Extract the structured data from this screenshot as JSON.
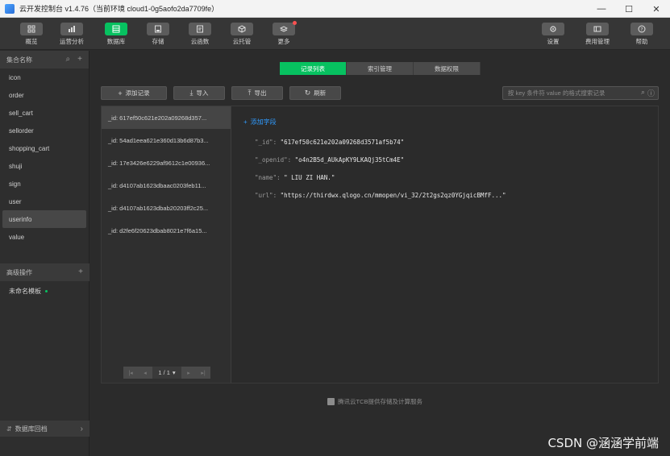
{
  "window": {
    "title": "云开发控制台 v1.4.76（当前环境 cloud1-0g5aofo2da7709fe）",
    "controls": [
      "—",
      "☐",
      "✕"
    ]
  },
  "toolbar": {
    "left": [
      {
        "label": "概览",
        "icon": "overview-icon"
      },
      {
        "label": "运营分析",
        "icon": "analytics-icon"
      },
      {
        "label": "数据库",
        "icon": "database-icon",
        "active": true
      },
      {
        "label": "存储",
        "icon": "storage-icon"
      },
      {
        "label": "云函数",
        "icon": "function-icon"
      },
      {
        "label": "云托管",
        "icon": "cloud-hosting-icon"
      },
      {
        "label": "更多",
        "icon": "more-icon",
        "badge": true
      }
    ],
    "right": [
      {
        "label": "设置",
        "icon": "gear-icon"
      },
      {
        "label": "费用管理",
        "icon": "billing-icon"
      },
      {
        "label": "帮助",
        "icon": "help-icon"
      }
    ]
  },
  "sidebar": {
    "header": "集合名称",
    "collections": [
      "icon",
      "order",
      "sell_cart",
      "sellorder",
      "shopping_cart",
      "shuji",
      "sign",
      "user",
      "userinfo",
      "value"
    ],
    "selected_collection": "userinfo",
    "advanced_header": "高级操作",
    "template_label": "未命名模板",
    "footer": "数据库回档"
  },
  "main": {
    "tabs": [
      "记录列表",
      "索引管理",
      "数据权限"
    ],
    "active_tab": "记录列表",
    "actions": {
      "add": "添加记录",
      "import": "导入",
      "export": "导出",
      "refresh": "刷新"
    },
    "search_placeholder": "按 key 条件符 value 的格式搜索记录",
    "records": [
      "_id: 617ef50c621e202a09268d357...",
      "_id: 54ad1eea621e360d13b6d87b3...",
      "_id: 17e3426e6229af9612c1e00936...",
      "_id: d4107ab1623dbaac0203feb11...",
      "_id: d4107ab1623dbab20203ff2c25...",
      "_id: d2fe6f20623dbab8021e7f6a15..."
    ],
    "pagination": "1 / 1",
    "add_field": "添加字段",
    "fields": [
      {
        "key": "\"_id\":",
        "value": "\"617ef50c621e202a09268d3571af5b74\""
      },
      {
        "key": "\"_openid\":",
        "value": "\"o4n2B5d_AUkApKY9LKAQj35tCm4E\""
      },
      {
        "key": "\"name\":",
        "value": "\" LIU ZI HAN.\""
      },
      {
        "key": "\"url\":",
        "value": "\"https://thirdwx.qlogo.cn/mmopen/vi_32/2t2gs2qz0YGjqicBMfF...\""
      }
    ],
    "powered_by": "腾讯云TCB提供存储及计算服务"
  },
  "watermark": "CSDN @涵涵学前端",
  "colors": {
    "accent": "#07c160",
    "link": "#2f9bff",
    "background": "#2b2b2b",
    "badge": "#fa5151"
  }
}
